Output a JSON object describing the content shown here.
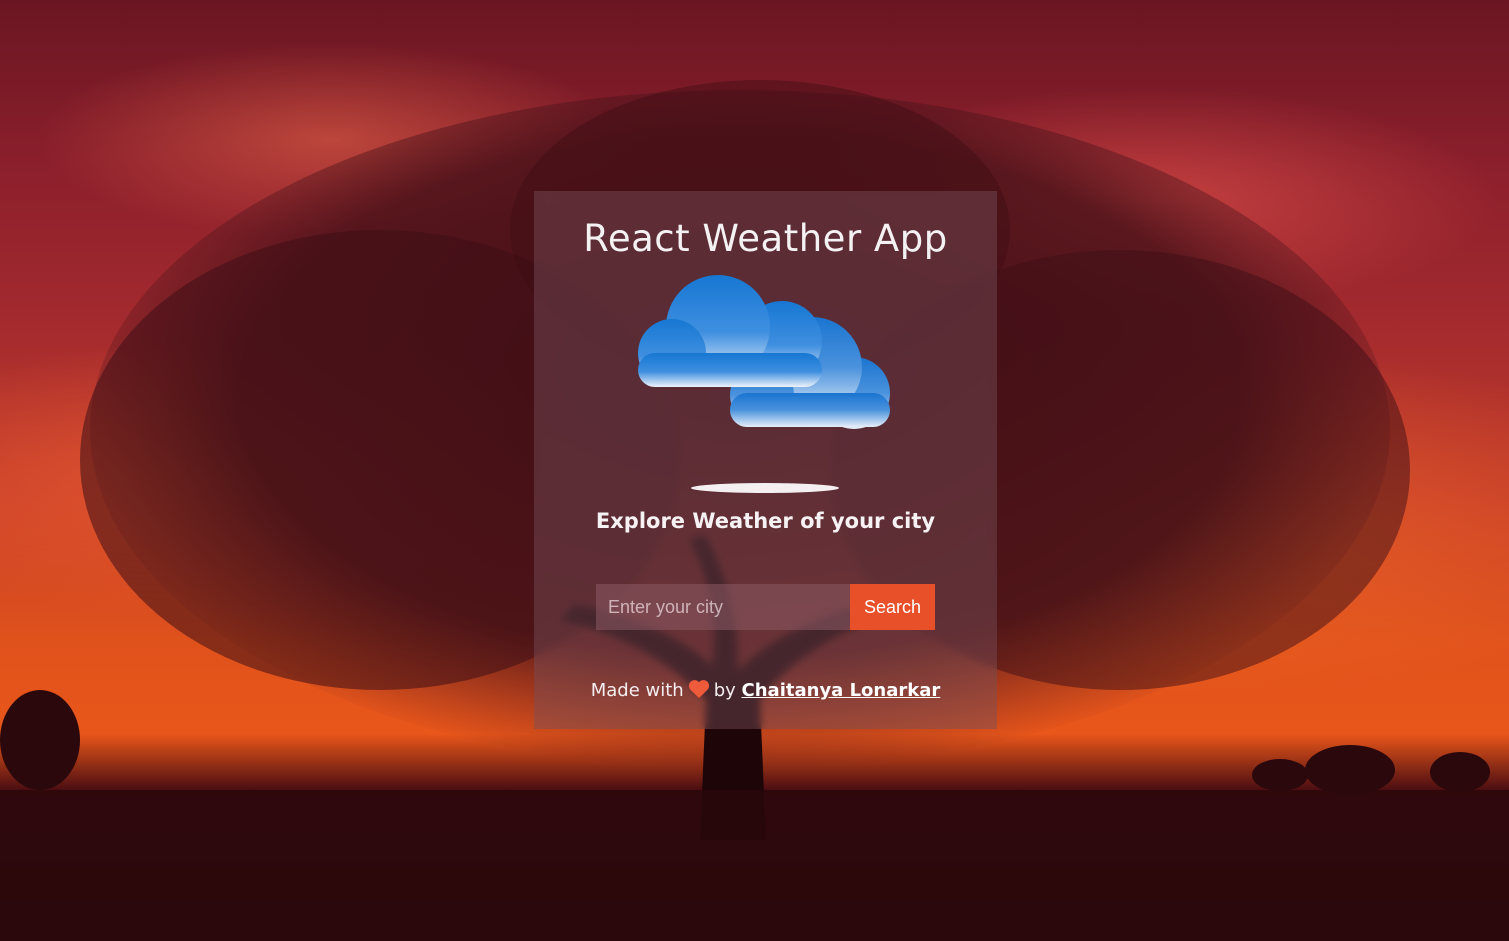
{
  "app": {
    "title": "React Weather App",
    "tagline": "Explore Weather of your city"
  },
  "search": {
    "placeholder": "Enter your city",
    "value": "",
    "button_label": "Search"
  },
  "footer": {
    "prefix": "Made with",
    "middle": "by",
    "author": "Chaitanya Lonarkar"
  },
  "icons": {
    "weather": "cloud-icon",
    "footer": "heart-icon"
  },
  "colors": {
    "accent": "#e8502a",
    "heart": "#ef5a3a",
    "cloud_top": "#1677d2",
    "cloud_bottom": "#e6eef8"
  }
}
